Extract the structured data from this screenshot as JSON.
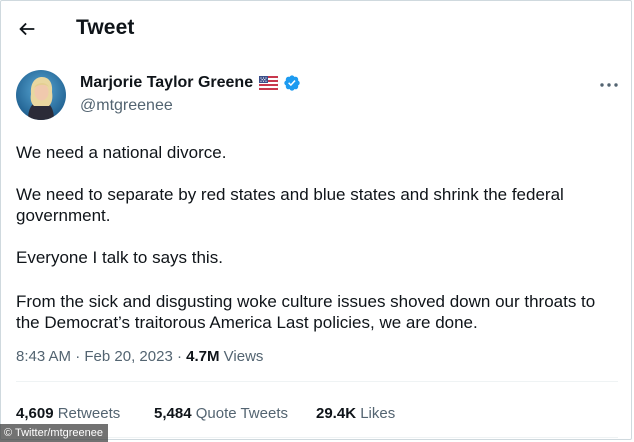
{
  "header": {
    "title": "Tweet"
  },
  "author": {
    "name": "Marjorie Taylor Greene",
    "handle": "@mtgreenee",
    "badges": [
      "us-flag-icon",
      "verified-icon"
    ],
    "verified_color": "#1d9bf0"
  },
  "tweet": {
    "paragraphs": [
      "We need a national divorce.",
      "We need to separate by red states and blue states and shrink the federal government.",
      "Everyone I talk to says this.",
      "From the sick and disgusting woke culture issues shoved down our throats to the Democrat’s traitorous America Last policies, we are done."
    ],
    "time": "8:43 AM",
    "separator": "·",
    "date": "Feb 20, 2023",
    "views_count": "4.7M",
    "views_label": "Views"
  },
  "stats": {
    "retweets_count": "4,609",
    "retweets_label": "Retweets",
    "quotes_count": "5,484",
    "quotes_label": "Quote Tweets",
    "likes_count": "29.4K",
    "likes_label": "Likes"
  },
  "credit": "© Twitter/mtgreenee",
  "colors": {
    "text": "#0f1419",
    "secondary": "#536471",
    "divider": "#eff3f4",
    "accent": "#1d9bf0"
  }
}
